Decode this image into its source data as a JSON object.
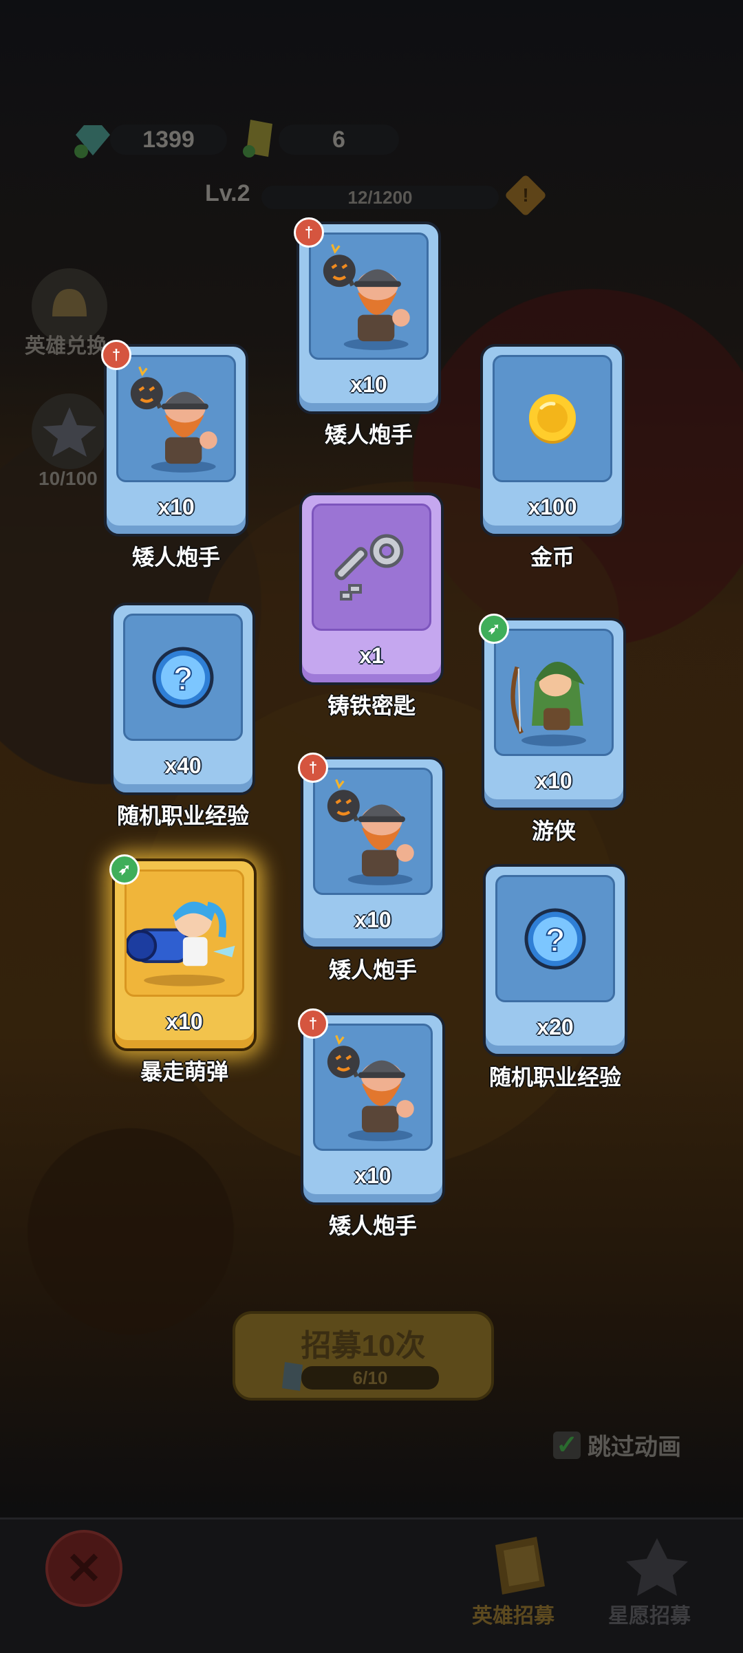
{
  "hud": {
    "gems": "1399",
    "tickets": "6",
    "level": "Lv.2",
    "exp": "12/1200",
    "warning_icon": "!"
  },
  "side_buttons": [
    {
      "label": "英雄兑换",
      "icon": "helmet-icon"
    },
    {
      "label": "10/100",
      "icon": "star-crystal-icon"
    }
  ],
  "cards": [
    {
      "name": "矮人炮手",
      "count": "x10",
      "rarity": "blue",
      "class_badge": "dagger",
      "icon": "dwarf-gunner"
    },
    {
      "name": "矮人炮手",
      "count": "x10",
      "rarity": "blue",
      "class_badge": "dagger",
      "icon": "dwarf-gunner"
    },
    {
      "name": "金币",
      "count": "x100",
      "rarity": "blue",
      "icon": "gold-coin"
    },
    {
      "name": "铸铁密匙",
      "count": "x1",
      "rarity": "purple",
      "icon": "iron-key"
    },
    {
      "name": "随机职业经验",
      "count": "x40",
      "rarity": "blue",
      "icon": "question-orb"
    },
    {
      "name": "游侠",
      "count": "x10",
      "rarity": "blue",
      "class_badge": "bow",
      "icon": "ranger"
    },
    {
      "name": "矮人炮手",
      "count": "x10",
      "rarity": "blue",
      "class_badge": "dagger",
      "icon": "dwarf-gunner"
    },
    {
      "name": "暴走萌弹",
      "count": "x10",
      "rarity": "gold",
      "class_badge": "bow",
      "icon": "cannon-girl"
    },
    {
      "name": "随机职业经验",
      "count": "x20",
      "rarity": "blue",
      "icon": "question-orb"
    },
    {
      "name": "矮人炮手",
      "count": "x10",
      "rarity": "blue",
      "class_badge": "dagger",
      "icon": "dwarf-gunner"
    }
  ],
  "recruit": {
    "title": "招募10次",
    "progress": "6/10"
  },
  "skip_animation": {
    "label": "跳过动画",
    "checked": true
  },
  "bottom_tabs": {
    "hero": "英雄招募",
    "wish": "星愿招募"
  },
  "colors": {
    "card_blue": "#9cc8ee",
    "card_purple": "#c5a7ef",
    "card_gold": "#f2c34c",
    "badge_red": "#d5553f",
    "badge_green": "#3fae5a"
  }
}
